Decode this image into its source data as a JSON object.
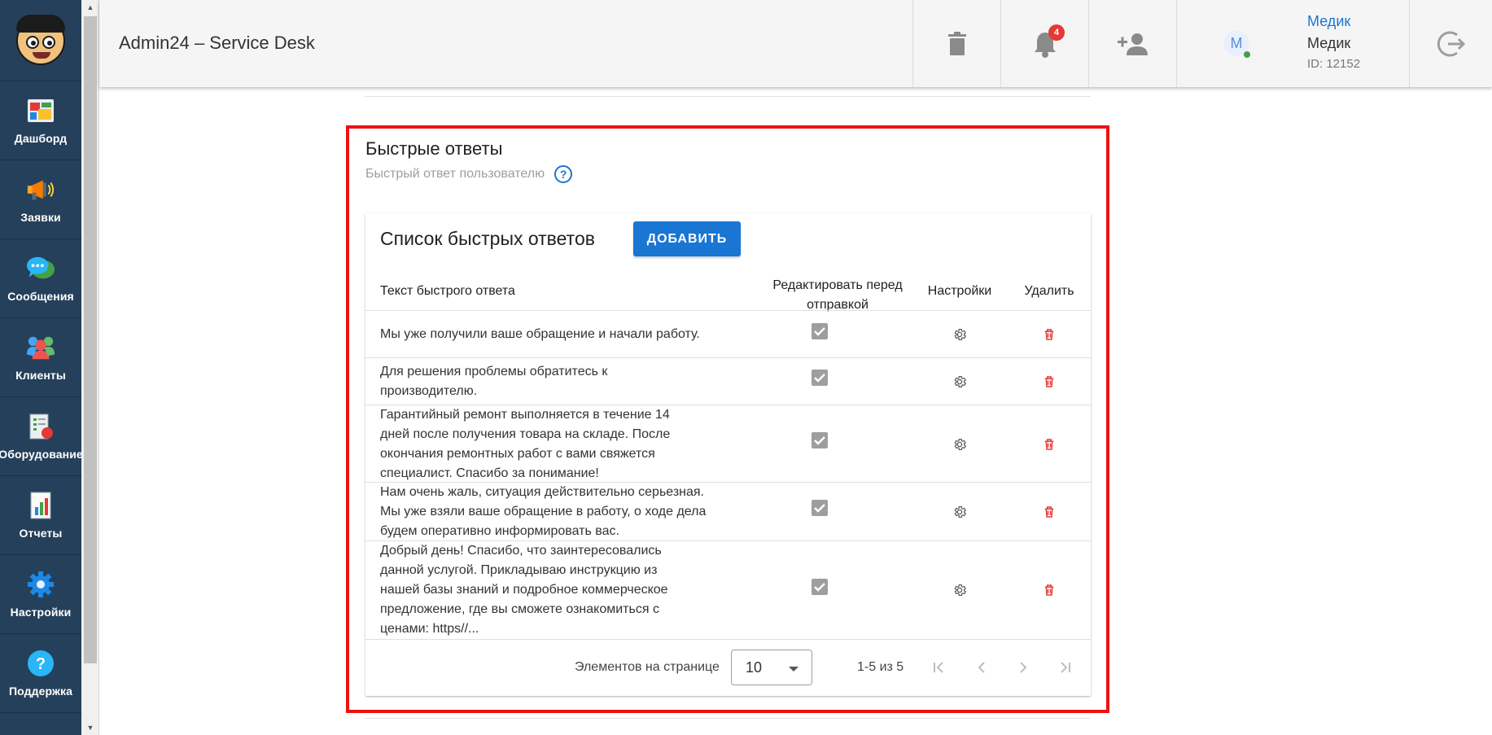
{
  "sidebar": {
    "items": [
      {
        "label": "Дашборд",
        "icon": "dashboard-icon"
      },
      {
        "label": "Заявки",
        "icon": "megaphone-icon"
      },
      {
        "label": "Сообщения",
        "icon": "chat-bubbles-icon"
      },
      {
        "label": "Клиенты",
        "icon": "users-icon"
      },
      {
        "label": "Оборудование",
        "icon": "equipment-icon"
      },
      {
        "label": "Отчеты",
        "icon": "report-icon"
      },
      {
        "label": "Настройки",
        "icon": "gear-icon"
      },
      {
        "label": "Поддержка",
        "icon": "help-icon"
      }
    ]
  },
  "header": {
    "title": "Admin24 – Service Desk",
    "notifications_count": "4",
    "user": {
      "avatar_letter": "М",
      "link": "Медик",
      "name": "Медик",
      "id": "ID: 12152"
    }
  },
  "section": {
    "title": "Быстрые ответы",
    "subtitle": "Быстрый ответ пользователю",
    "help_symbol": "?"
  },
  "card": {
    "title": "Список быстрых ответов",
    "add_label": "ДОБАВИТЬ",
    "columns": {
      "text": "Текст быстрого ответа",
      "edit": "Редактировать перед отправкой",
      "settings": "Настройки",
      "delete": "Удалить"
    },
    "rows": [
      {
        "text": "Мы уже получили ваше обращение и начали работу.",
        "edit_before_send": true
      },
      {
        "text": "Для решения проблемы обратитесь к производителю.",
        "edit_before_send": true
      },
      {
        "text": "Гарантийный ремонт выполняется в течение 14 дней после получения товара на складе. После окончания ремонтных работ с вами свяжется специалист. Спасибо за понимание!",
        "edit_before_send": true
      },
      {
        "text": "Нам очень жаль, ситуация действительно серьезная. Мы уже взяли ваше обращение в работу, о ходе дела будем оперативно информировать вас.",
        "edit_before_send": true
      },
      {
        "text": "Добрый день! Спасибо, что заинтересовались данной услугой. Прикладываю инструкцию из нашей базы знаний и подробное коммерческое предложение, где вы сможете ознакомиться с ценами: https//...",
        "edit_before_send": true
      }
    ],
    "pagination": {
      "per_page_label": "Элементов на странице",
      "per_page_value": "10",
      "range": "1-5 из 5"
    }
  },
  "colors": {
    "sidebar": "#25405b",
    "accent": "#1976d2",
    "highlight": "#ee1111",
    "delete": "#e53935"
  }
}
